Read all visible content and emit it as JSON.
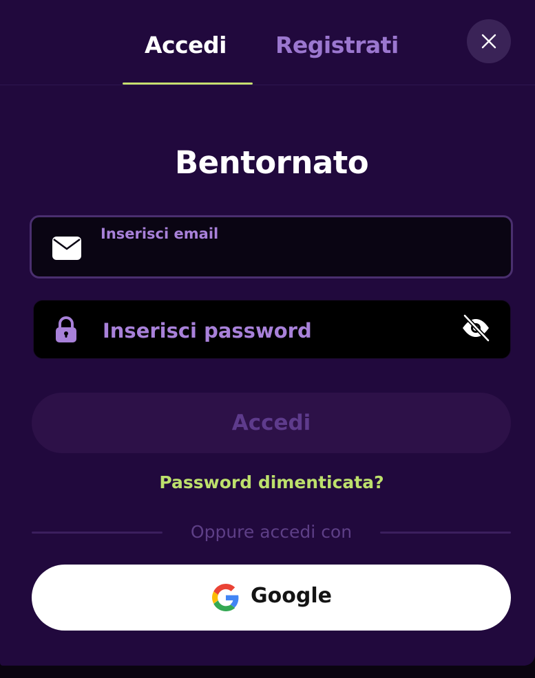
{
  "tabs": {
    "login": "Accedi",
    "register": "Registrati"
  },
  "title": "Bentornato",
  "email": {
    "label": "Inserisci email",
    "value": "",
    "icon": "envelope-icon"
  },
  "password": {
    "placeholder": "Inserisci password",
    "value": "",
    "icon": "lock-icon",
    "toggle_icon": "eye-off-icon"
  },
  "submit_label": "Accedi",
  "forgot_label": "Password dimenticata?",
  "divider_text": "Oppure accedi con",
  "google": {
    "label": "Google",
    "icon": "google-icon"
  },
  "colors": {
    "background": "#21093d",
    "accent": "#c7df6f",
    "link": "#bde06c",
    "muted_purple": "#a881d9"
  }
}
